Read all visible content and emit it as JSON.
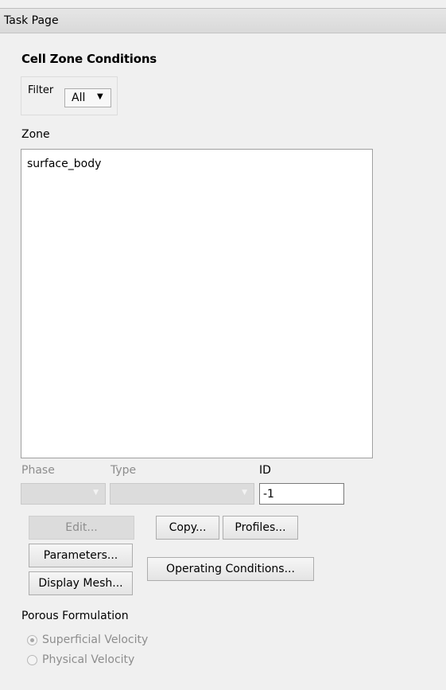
{
  "title_bar": {
    "title": "Task Page"
  },
  "panel": {
    "heading": "Cell Zone Conditions",
    "filter": {
      "label": "Filter",
      "selected": "All"
    },
    "zone": {
      "label": "Zone",
      "items": [
        "surface_body"
      ]
    },
    "phase": {
      "label": "Phase",
      "value": ""
    },
    "type": {
      "label": "Type",
      "value": ""
    },
    "id": {
      "label": "ID",
      "value": "-1"
    },
    "buttons": {
      "edit": "Edit...",
      "copy": "Copy...",
      "profiles": "Profiles...",
      "parameters": "Parameters...",
      "display_mesh": "Display Mesh...",
      "operating_conditions": "Operating Conditions..."
    },
    "porous_formulation": {
      "label": "Porous Formulation",
      "options": [
        "Superficial Velocity",
        "Physical Velocity"
      ],
      "selected": "Superficial Velocity"
    }
  }
}
